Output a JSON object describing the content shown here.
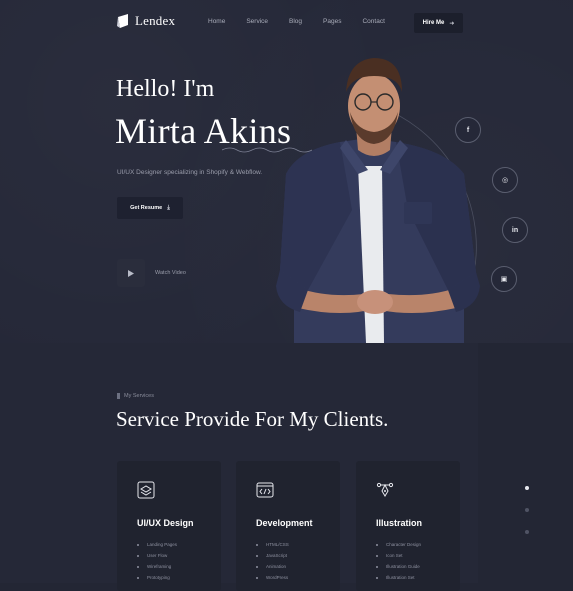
{
  "header": {
    "logo_text": "Lendex",
    "nav": [
      "Home",
      "Service",
      "Blog",
      "Pages",
      "Contact"
    ],
    "hire_label": "Hire Me"
  },
  "hero": {
    "greeting": "Hello! I'm",
    "name": "Mirta Akins",
    "subtitle": "UI/UX Designer specializing in Shopify & Webflow.",
    "resume_label": "Get Resume",
    "watch_label": "Watch Video"
  },
  "socials": [
    {
      "label": "f",
      "icon": "facebook-icon"
    },
    {
      "label": "◎",
      "icon": "dribbble-icon"
    },
    {
      "label": "in",
      "icon": "linkedin-icon"
    },
    {
      "label": "▣",
      "icon": "instagram-icon"
    }
  ],
  "services": {
    "eyebrow": "My Services",
    "title": "Service Provide For My Clients.",
    "cards": [
      {
        "title": "UI/UX Design",
        "icon": "layers-icon",
        "items": [
          "Landing Pages",
          "User Flow",
          "Wireframing",
          "Prototyping"
        ]
      },
      {
        "title": "Development",
        "icon": "code-icon",
        "items": [
          "HTML/CSS",
          "JavaScript",
          "Animation",
          "WordPress"
        ]
      },
      {
        "title": "Illustration",
        "icon": "pen-tool-icon",
        "items": [
          "Character Design",
          "Icon Set",
          "Illustration Guide",
          "Illustration Set"
        ]
      }
    ]
  },
  "colors": {
    "background": "#232634",
    "hero_background": "#252838",
    "card_background": "#20232f",
    "muted_text": "#9a9dab",
    "accent_white": "#ffffff"
  }
}
